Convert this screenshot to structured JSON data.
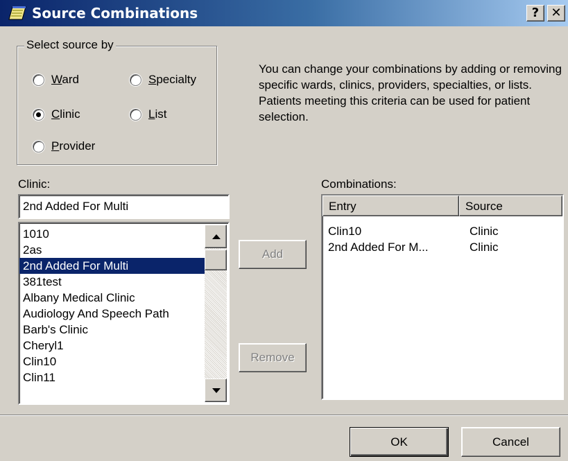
{
  "window": {
    "title": "Source Combinations",
    "help_label": "?",
    "close_label": "✕"
  },
  "select_source": {
    "legend": "Select source by",
    "options": [
      {
        "prefix": "",
        "accel": "W",
        "rest": "ard",
        "checked": false
      },
      {
        "prefix": "",
        "accel": "S",
        "rest": "pecialty",
        "checked": false
      },
      {
        "prefix": "",
        "accel": "C",
        "rest": "linic",
        "checked": true
      },
      {
        "prefix": "",
        "accel": "L",
        "rest": "ist",
        "checked": false
      },
      {
        "prefix": "",
        "accel": "P",
        "rest": "rovider",
        "checked": false
      }
    ]
  },
  "info_text": "You can change your combinations by adding or removing  specific wards, clinics, providers, specialties, or lists. Patients meeting this criteria can be used for patient selection.",
  "clinic": {
    "label": "Clinic:",
    "search_value": "2nd Added For Multi",
    "items": [
      "1010",
      "2as",
      "2nd Added For Multi",
      "381test",
      "Albany Medical Clinic",
      "Audiology And Speech Path",
      "Barb's Clinic",
      "Cheryl1",
      "Clin10",
      "Clin11"
    ],
    "selected": "2nd Added For Multi"
  },
  "actions": {
    "add_label": "Add",
    "remove_label": "Remove"
  },
  "combinations": {
    "label": "Combinations:",
    "columns": [
      "Entry",
      "Source"
    ],
    "rows": [
      {
        "entry": "Clin10",
        "source": "Clinic"
      },
      {
        "entry": "2nd Added For M...",
        "source": "Clinic"
      }
    ]
  },
  "footer": {
    "ok_label": "OK",
    "cancel_label": "Cancel"
  }
}
